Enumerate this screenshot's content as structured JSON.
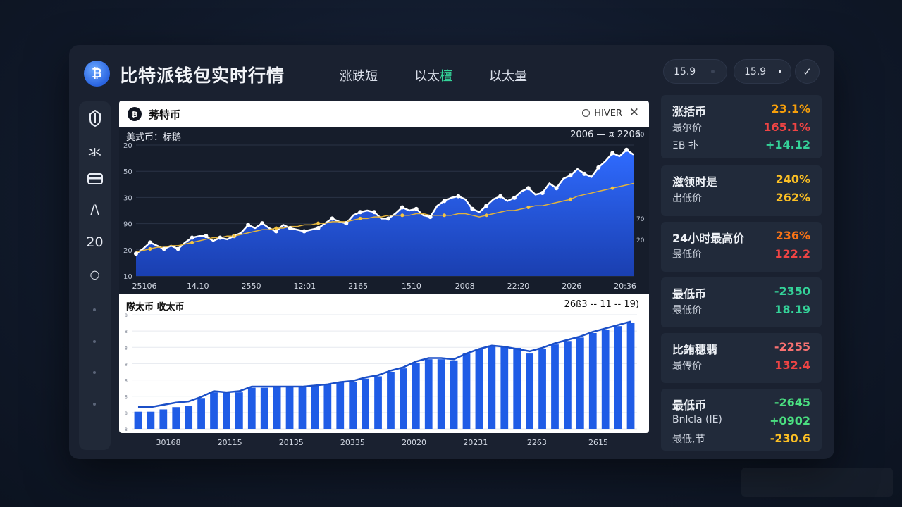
{
  "header": {
    "logo_glyph": "₿",
    "title": "比特派钱包实时行情",
    "tabs": [
      {
        "label": "涨跌短",
        "accent": ""
      },
      {
        "label": "以太",
        "accent": "檀"
      },
      {
        "label": "以太量",
        "accent": ""
      }
    ],
    "pills": [
      {
        "value": "15.9",
        "dot_color": "#3a4356"
      },
      {
        "value": "15.9",
        "dot_color": "#e8ecf4"
      }
    ],
    "check_icon": "✓"
  },
  "rail": {
    "items": [
      {
        "icon": "shield-icon",
        "glyph": "◊"
      },
      {
        "icon": "chart-icon",
        "glyph": "氺"
      },
      {
        "icon": "card-icon",
        "glyph": "▭"
      },
      {
        "icon": "bracket-icon",
        "glyph": "/\\"
      },
      {
        "icon": "count-text",
        "glyph": "20"
      },
      {
        "icon": "circle-icon",
        "glyph": "○"
      }
    ]
  },
  "top_card": {
    "coin_glyph": "₿",
    "title": "莠特币",
    "hiver_label": "HIVER",
    "close_glyph": "✕",
    "subtitle": "美式币：标鹅",
    "range": "2006 — ¤ 2206"
  },
  "bottom_card": {
    "title": "隊太币 收太币",
    "range": "26ß3 -- 11 -- 19)"
  },
  "chart_data": [
    {
      "type": "area",
      "title": "",
      "y_ticks": [
        "20",
        "50",
        "30",
        "90",
        "20",
        "10"
      ],
      "x_ticks": [
        "25106",
        "14.10",
        "2550",
        "12:01",
        "2165",
        "1510",
        "2008",
        "22:20",
        "2026",
        "20:36"
      ],
      "right_ticks": [
        "20",
        "70",
        "20"
      ],
      "series": [
        {
          "values": [
            14,
            17,
            21,
            19,
            17,
            19,
            17,
            21,
            24,
            25,
            25,
            22,
            24,
            23,
            25,
            27,
            32,
            30,
            33,
            30,
            28,
            32,
            30,
            29,
            28,
            29,
            30,
            33,
            36,
            34,
            33,
            38,
            40,
            41,
            40,
            36,
            36,
            39,
            43,
            41,
            42,
            38,
            37,
            44,
            47,
            49,
            50,
            48,
            42,
            40,
            44,
            48,
            50,
            47,
            49,
            53,
            55,
            51,
            52,
            58,
            55,
            61,
            63,
            67,
            64,
            62,
            68,
            72,
            77,
            75,
            79,
            76
          ]
        },
        {
          "values": [
            15,
            16,
            17,
            18,
            18,
            19,
            19,
            20,
            21,
            22,
            23,
            24,
            24,
            25,
            25,
            26,
            27,
            28,
            29,
            29,
            30,
            30,
            31,
            31,
            32,
            32,
            33,
            33,
            34,
            34,
            34,
            35,
            36,
            36,
            37,
            37,
            38,
            38,
            38,
            38,
            39,
            39,
            38,
            38,
            38,
            38,
            39,
            39,
            38,
            37,
            38,
            39,
            40,
            41,
            41,
            42,
            43,
            44,
            44,
            45,
            46,
            47,
            48,
            50,
            51,
            52,
            53,
            54,
            55,
            56,
            57,
            58
          ]
        }
      ]
    },
    {
      "type": "bar",
      "title": "",
      "x_ticks": [
        "30168",
        "20115",
        "20135",
        "20335",
        "20020",
        "20231",
        "2263",
        "2615"
      ],
      "series": [
        {
          "values": [
            15,
            15,
            17,
            19,
            20,
            27,
            32,
            32,
            32,
            36,
            36,
            37,
            37,
            37,
            38,
            39,
            41,
            41,
            44,
            46,
            50,
            53,
            58,
            61,
            61,
            60,
            66,
            70,
            73,
            72,
            71,
            66,
            70,
            74,
            77,
            80,
            84,
            87,
            90,
            93
          ]
        },
        {
          "values": [
            19,
            19,
            21,
            23,
            24,
            28,
            33,
            32,
            33,
            37,
            37,
            37,
            37,
            37,
            38,
            39,
            41,
            42,
            45,
            47,
            51,
            54,
            59,
            62,
            62,
            61,
            66,
            70,
            73,
            72,
            70,
            68,
            71,
            75,
            78,
            81,
            85,
            88,
            91,
            94
          ]
        }
      ]
    }
  ],
  "stats": [
    {
      "rows": [
        {
          "label": "涨括币",
          "value": "23.1%",
          "color": "#f59e0b",
          "big": true
        },
        {
          "label": "最尔价",
          "value": "165.1%",
          "color": "#ef4444",
          "big": false
        },
        {
          "label": "ΞΒ 扑",
          "value": "+14.12",
          "color": "#34d399",
          "big": false
        }
      ]
    },
    {
      "rows": [
        {
          "label": "滋领时是",
          "value": "240%",
          "color": "#fbbf24",
          "big": true
        },
        {
          "label": "出低价",
          "value": "262%",
          "color": "#fbbf24",
          "big": false
        }
      ]
    },
    {
      "rows": [
        {
          "label": "24小时最高价",
          "value": "236%",
          "color": "#f97316",
          "big": true
        },
        {
          "label": "最低价",
          "value": "122.2",
          "color": "#ef4444",
          "big": false
        }
      ]
    },
    {
      "rows": [
        {
          "label": "最低币",
          "value": "-2350",
          "color": "#34d399",
          "big": true
        },
        {
          "label": "最低价",
          "value": "18.19",
          "color": "#34d399",
          "big": false
        }
      ]
    },
    {
      "rows": [
        {
          "label": "比銪穗翡",
          "value": "-2255",
          "color": "#f87171",
          "big": true
        },
        {
          "label": "最传价",
          "value": "132.4",
          "color": "#ef4444",
          "big": false
        }
      ]
    },
    {
      "rows": [
        {
          "label": "最低币",
          "value": "-2645",
          "color": "#4ade80",
          "big": true
        },
        {
          "label": "Bnlcla (IE)",
          "value": "+0902",
          "color": "#4ade80",
          "big": false
        },
        {
          "label": "最低,节",
          "value": "-230.6",
          "color": "#fbbf24",
          "big": false
        }
      ]
    }
  ]
}
